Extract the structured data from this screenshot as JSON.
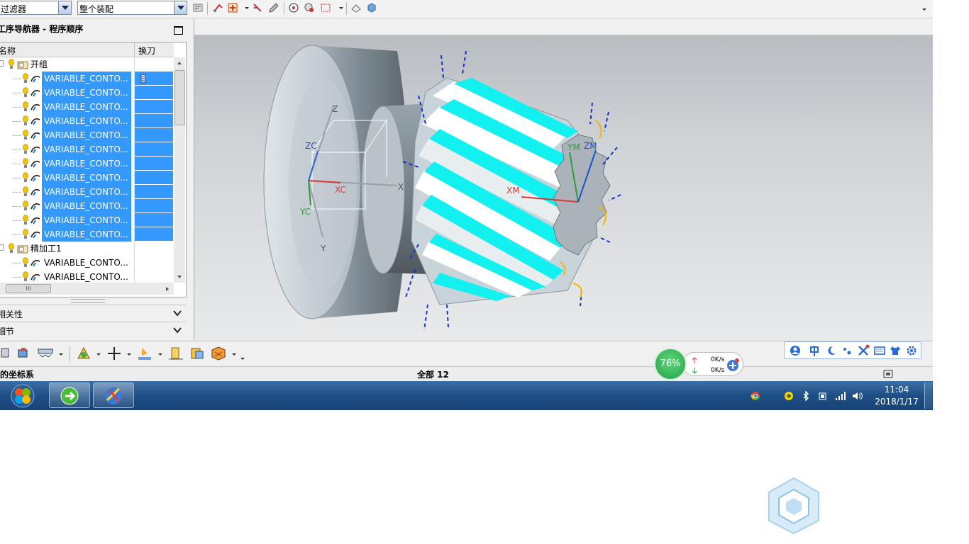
{
  "toolbar": {
    "filter_value": "过滤器",
    "assembly_value": "整个装配"
  },
  "navigator": {
    "title": "工序导航器 - 程序顺序",
    "col_name": "名称",
    "col_tool": "换刀",
    "groups": [
      {
        "label": "开组",
        "ops": [
          {
            "label": "VARIABLE_CONTO...",
            "selected": true
          },
          {
            "label": "VARIABLE_CONTO...",
            "selected": true
          },
          {
            "label": "VARIABLE_CONTO...",
            "selected": true
          },
          {
            "label": "VARIABLE_CONTO...",
            "selected": true
          },
          {
            "label": "VARIABLE_CONTO...",
            "selected": true
          },
          {
            "label": "VARIABLE_CONTO...",
            "selected": true
          },
          {
            "label": "VARIABLE_CONTO...",
            "selected": true
          },
          {
            "label": "VARIABLE_CONTO...",
            "selected": true
          },
          {
            "label": "VARIABLE_CONTO...",
            "selected": true
          },
          {
            "label": "VARIABLE_CONTO...",
            "selected": true
          },
          {
            "label": "VARIABLE_CONTO...",
            "selected": true
          },
          {
            "label": "VARIABLE_CONTO...",
            "selected": true
          }
        ]
      },
      {
        "label": "精加工1",
        "ops": [
          {
            "label": "VARIABLE_CONTO...",
            "selected": false
          },
          {
            "label": "VARIABLE_CONTO...",
            "selected": false
          }
        ]
      }
    ],
    "section_dependencies": "相关性",
    "section_details": "细节",
    "hscroll_thumb_text": "III"
  },
  "viewport": {
    "axis_labels": {
      "zc": "ZC",
      "xc": "XC",
      "yc": "YC",
      "z": "Z",
      "x": "X",
      "y": "Y",
      "xm": "XM",
      "ym": "YM",
      "zm": "ZM"
    }
  },
  "status": {
    "left": "的坐标系",
    "center": "全部 12"
  },
  "speed_widget": {
    "percent": "76%",
    "upload": "0K/s",
    "download": "0K/s"
  },
  "taskbar": {
    "time": "11:04",
    "date": "2018/1/17"
  },
  "colors": {
    "selection": "#3399ff",
    "toolpath_cyan": "#12f0f0",
    "gear_body": "#c9d3da",
    "taskbar": "#1e4f86"
  }
}
